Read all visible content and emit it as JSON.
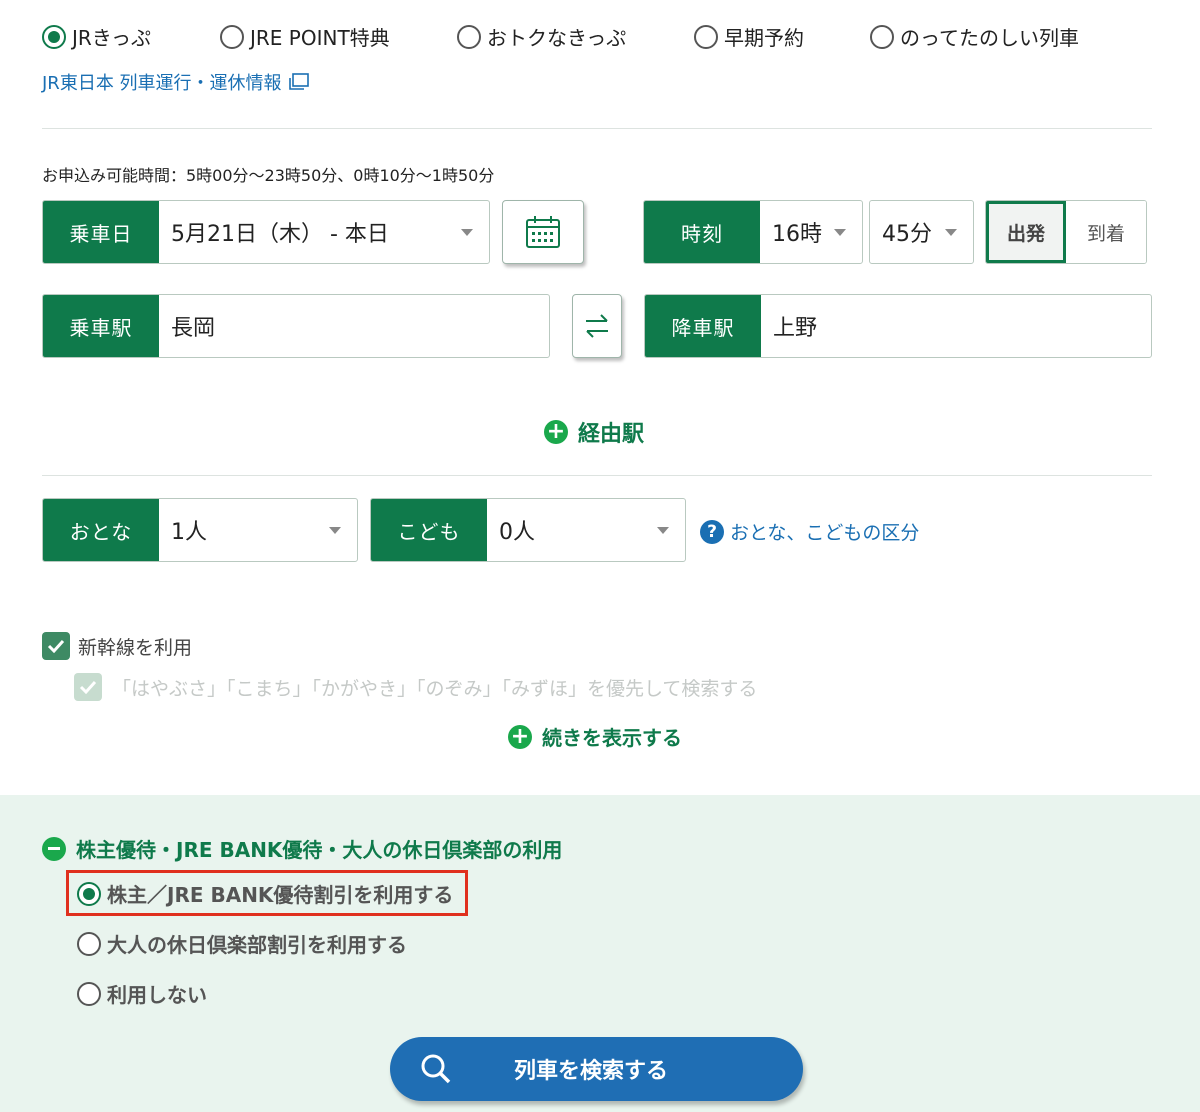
{
  "ticket_types": [
    {
      "label": "JRきっぷ",
      "selected": true
    },
    {
      "label": "JRE POINT特典",
      "selected": false
    },
    {
      "label": "おトクなきっぷ",
      "selected": false
    },
    {
      "label": "早期予約",
      "selected": false
    },
    {
      "label": "のってたのしい列車",
      "selected": false
    }
  ],
  "service_info_link": "JR東日本 列車運行・運休情報",
  "hours_note": "お申込み可能時間：5時00分〜23時50分、0時10分〜1時50分",
  "date": {
    "label": "乗車日",
    "value": "5月21日（木） - 本日"
  },
  "time": {
    "label": "時刻",
    "hour": "16時",
    "minute": "45分",
    "depart": "出発",
    "arrive": "到着",
    "selected": "出発"
  },
  "from_station": {
    "label": "乗車駅",
    "value": "長岡"
  },
  "to_station": {
    "label": "降車駅",
    "value": "上野"
  },
  "via_label": "経由駅",
  "adults": {
    "label": "おとな",
    "value": "1人"
  },
  "children": {
    "label": "こども",
    "value": "0人"
  },
  "age_info_link": "おとな、こどもの区分",
  "shinkansen_checkbox": {
    "label": "新幹線を利用",
    "checked": true
  },
  "priority_checkbox": {
    "label": "「はやぶさ」「こまち」「かがやき」「のぞみ」「みずほ」を優先して検索する",
    "checked": true,
    "disabled": true
  },
  "show_more_label": "続きを表示する",
  "discount_section": {
    "title": "株主優待・JRE BANK優待・大人の休日倶楽部の利用",
    "options": [
      {
        "label": "株主／JRE BANK優待割引を利用する",
        "selected": true
      },
      {
        "label": "大人の休日倶楽部割引を利用する",
        "selected": false
      },
      {
        "label": "利用しない",
        "selected": false
      }
    ]
  },
  "search_button": "列車を検索する",
  "colors": {
    "primary_green": "#0f7a4b",
    "link_blue": "#1a6fb3",
    "search_blue": "#1f6eb4",
    "highlight_red": "#e0301e",
    "section_bg": "#e9f4ee"
  }
}
